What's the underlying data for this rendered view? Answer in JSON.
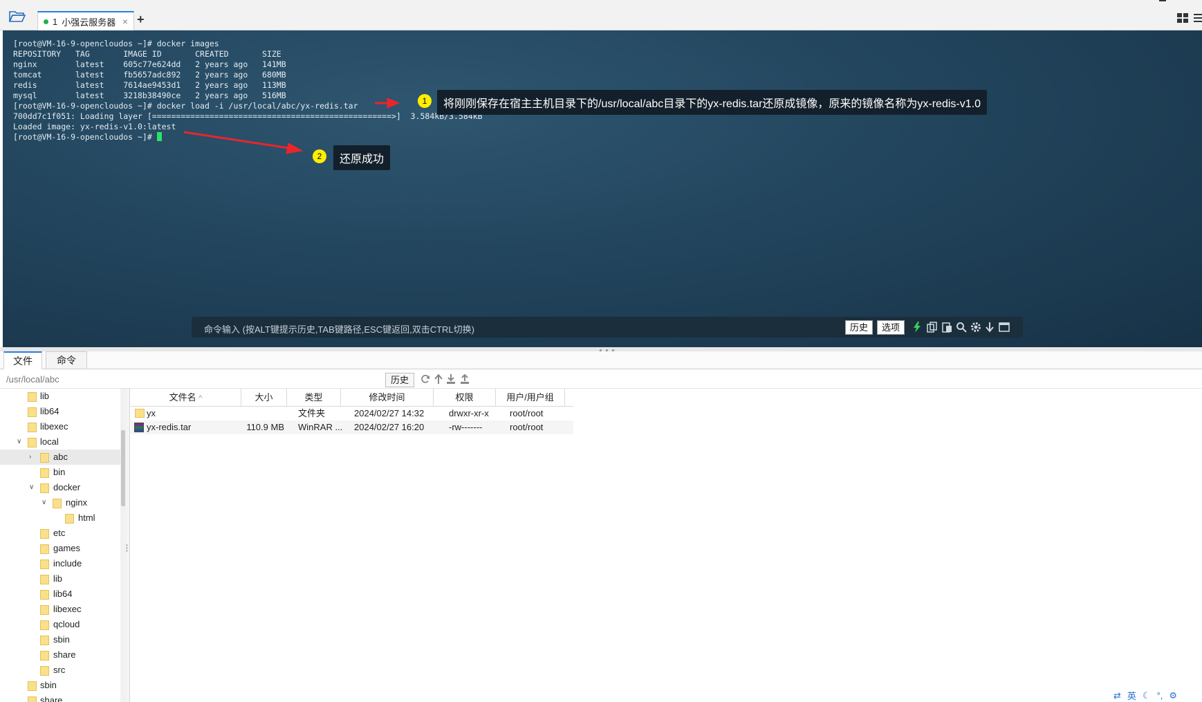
{
  "tabbar": {
    "tab_number": "1",
    "tab_title": "小强云服务器",
    "close": "×",
    "add": "+"
  },
  "terminal": {
    "lines": [
      "[root@VM-16-9-opencloudos ~]# docker images",
      "REPOSITORY   TAG       IMAGE ID       CREATED       SIZE",
      "nginx        latest    605c77e624dd   2 years ago   141MB",
      "tomcat       latest    fb5657adc892   2 years ago   680MB",
      "redis        latest    7614ae9453d1   2 years ago   113MB",
      "mysql        latest    3218b38490ce   2 years ago   516MB",
      "[root@VM-16-9-opencloudos ~]# docker load -i /usr/local/abc/yx-redis.tar",
      "700dd7c1f051: Loading layer [==================================================>]  3.584kB/3.584kB",
      "Loaded image: yx-redis-v1.0:latest"
    ],
    "prompt_line": "[root@VM-16-9-opencloudos ~]# ",
    "annotation_1": {
      "num": "1",
      "text": "将刚刚保存在宿主主机目录下的/usr/local/abc目录下的yx-redis.tar还原成镜像，原来的镜像名称为yx-redis-v1.0"
    },
    "annotation_2": {
      "num": "2",
      "text": "还原成功"
    },
    "arrow_color": "#e8262b",
    "command_bar": {
      "placeholder": "命令输入 (按ALT键提示历史,TAB键路径,ESC键返回,双击CTRL切换)",
      "history_label": "历史",
      "options_label": "选项"
    }
  },
  "panel": {
    "tabs": [
      "文件",
      "命令"
    ],
    "path": "/usr/local/abc",
    "history_label": "历史"
  },
  "tree": {
    "items": [
      {
        "label": "lib",
        "caret": ""
      },
      {
        "label": "lib64",
        "caret": ""
      },
      {
        "label": "libexec",
        "caret": ""
      },
      {
        "label": "local",
        "caret": "∨"
      },
      {
        "label": "abc",
        "caret": "›"
      },
      {
        "label": "bin",
        "caret": ""
      },
      {
        "label": "docker",
        "caret": "∨"
      },
      {
        "label": "nginx",
        "caret": "∨"
      },
      {
        "label": "html",
        "caret": ""
      },
      {
        "label": "etc",
        "caret": ""
      },
      {
        "label": "games",
        "caret": ""
      },
      {
        "label": "include",
        "caret": ""
      },
      {
        "label": "lib",
        "caret": ""
      },
      {
        "label": "lib64",
        "caret": ""
      },
      {
        "label": "libexec",
        "caret": ""
      },
      {
        "label": "qcloud",
        "caret": ""
      },
      {
        "label": "sbin",
        "caret": ""
      },
      {
        "label": "share",
        "caret": ""
      },
      {
        "label": "src",
        "caret": ""
      },
      {
        "label": "sbin",
        "caret": ""
      },
      {
        "label": "share",
        "caret": ""
      }
    ]
  },
  "files": {
    "columns": [
      "文件名",
      "大小",
      "类型",
      "修改时间",
      "权限",
      "用户/用户组"
    ],
    "sort_indicator": "^",
    "rows": [
      {
        "name": "yx",
        "size": "",
        "type": "文件夹",
        "mtime": "2024/02/27 14:32",
        "perm": "drwxr-xr-x",
        "owner": "root/root",
        "icon": "folder-icon"
      },
      {
        "name": "yx-redis.tar",
        "size": "110.9 MB",
        "type": "WinRAR ...",
        "mtime": "2024/02/27 16:20",
        "perm": "-rw-------",
        "owner": "root/root",
        "icon": "rar-archive-icon"
      }
    ]
  },
  "tray": {
    "ime_label": "英"
  }
}
